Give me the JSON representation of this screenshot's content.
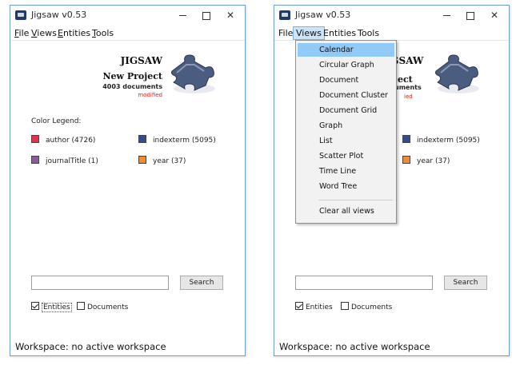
{
  "windows": [
    {
      "title": "Jigsaw v0.53",
      "menus": [
        "File",
        "Views",
        "Entities",
        "Tools"
      ],
      "app_name": "JIGSAW",
      "project_name": "New Project",
      "doc_count": "4003 documents",
      "status_flag": "modified",
      "legend_title": "Color Legend:",
      "legend": [
        {
          "label": "author (4726)",
          "color": "#e0334a"
        },
        {
          "label": "indexterm (5095)",
          "color": "#344c8c"
        },
        {
          "label": "journalTitle (1)",
          "color": "#8b5a9a"
        },
        {
          "label": "year (37)",
          "color": "#ee8c3c"
        }
      ],
      "search_value": "",
      "search_label": "Search",
      "checks": [
        {
          "label": "Entities",
          "checked": true
        },
        {
          "label": "Documents",
          "checked": false
        }
      ],
      "workspace_status": "Workspace: no active workspace"
    },
    {
      "title": "Jigsaw v0.53",
      "menus": [
        "File",
        "Views",
        "Entities",
        "Tools"
      ],
      "legend": [
        {
          "label": "indexterm (5095)",
          "color": "#344c8c"
        },
        {
          "label": "year (37)",
          "color": "#ee8c3c"
        }
      ],
      "doc_fragment": "uments",
      "flag_fragment": "ied",
      "search_value": "",
      "search_label": "Search",
      "checks": [
        {
          "label": "Entities",
          "checked": true
        },
        {
          "label": "Documents",
          "checked": false
        }
      ],
      "workspace_status": "Workspace: no active workspace",
      "open_menu": "Views",
      "views_menu": [
        "Calendar",
        "Circular Graph",
        "Document",
        "Document Cluster",
        "Document Grid",
        "Graph",
        "List",
        "Scatter Plot",
        "Time Line",
        "Word Tree"
      ],
      "views_menu_extra": "Clear all views",
      "highlighted_view": "Calendar",
      "app_name_fragment": "JIGSAW",
      "project_fragment": "ject"
    }
  ],
  "colors": {
    "window_border": "#6f9fd0",
    "menu_highlight": "#91c9f7",
    "modified_red": "#e0201a",
    "puzzle_piece": "#4a5c80"
  },
  "icons": {
    "window_icon": "jigsaw-app-icon",
    "logo": "puzzle-piece-icon",
    "minimize": "minimize-icon",
    "maximize": "maximize-icon",
    "close": "close-icon"
  }
}
